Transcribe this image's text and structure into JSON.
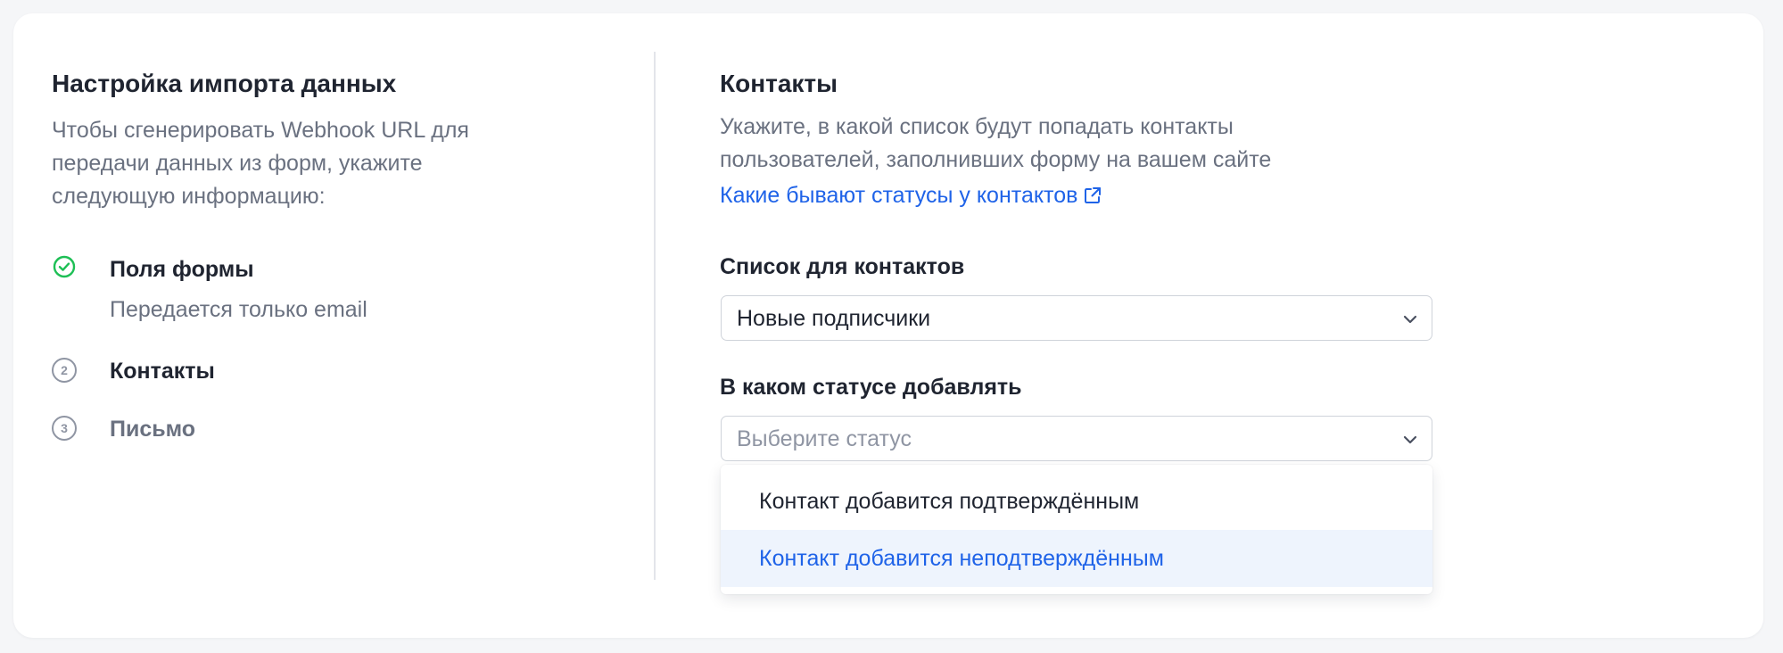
{
  "left": {
    "title": "Настройка импорта данных",
    "description_lines": [
      "Чтобы сгенерировать Webhook URL для",
      "передачи данных из форм, укажите",
      "следующую информацию:"
    ],
    "steps": [
      {
        "label": "Поля формы",
        "sub": "Передается только email",
        "state": "done",
        "number": ""
      },
      {
        "label": "Контакты",
        "state": "current",
        "number": "2"
      },
      {
        "label": "Письмо",
        "state": "pending",
        "number": "3"
      }
    ]
  },
  "right": {
    "title": "Контакты",
    "description_lines": [
      "Укажите, в какой список будут попадать контакты",
      "пользователей, заполнивших форму на вашем сайте"
    ],
    "link": "Какие бывают статусы у контактов",
    "list_field": {
      "label": "Список для контактов",
      "value": "Новые подписчики"
    },
    "status_field": {
      "label": "В каком статусе добавлять",
      "placeholder": "Выберите статус"
    },
    "status_options": [
      {
        "label": "Контакт добавится подтверждённым",
        "highlighted": false
      },
      {
        "label": "Контакт добавится неподтверждённым",
        "highlighted": true
      }
    ]
  },
  "colors": {
    "accent": "#1f63e8",
    "success": "#1dbf55",
    "muted": "#6a7180",
    "highlight_bg": "#eef4fd"
  },
  "icons": {
    "step_done": "check-circle-icon",
    "link": "external-link-icon",
    "select": "chevron-down-icon"
  }
}
